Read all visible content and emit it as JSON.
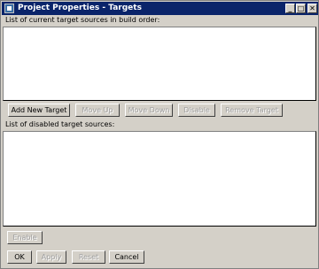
{
  "window": {
    "title": "Project Properties - Targets",
    "controls": {
      "minimize": "_",
      "maximize": "□",
      "close": "✕"
    }
  },
  "sections": {
    "current_label": "List of current target sources in build order:",
    "disabled_label": "List of disabled target sources:"
  },
  "current_buttons": {
    "add": "Add New Target",
    "move_up": "Move Up",
    "move_down": "Move Down",
    "disable": "Disable",
    "remove": "Remove Target"
  },
  "disabled_buttons": {
    "enable": "Enable"
  },
  "dialog_buttons": {
    "ok": "OK",
    "apply": "Apply",
    "reset": "Reset",
    "cancel": "Cancel"
  },
  "current_targets": [],
  "disabled_targets": []
}
